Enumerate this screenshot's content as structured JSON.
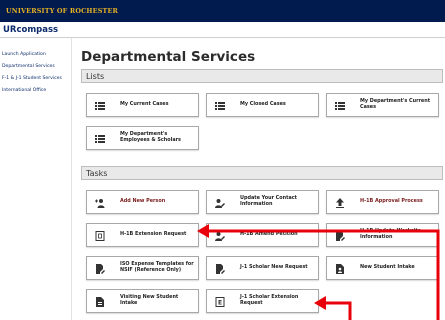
{
  "header": {
    "university": "UNIVERSITY OF ROCHESTER",
    "app_name": "URcompass"
  },
  "sidebar": {
    "items": [
      {
        "label": "Launch Application"
      },
      {
        "label": "Departmental Services"
      },
      {
        "label": "F-1 & J-1 Student Services"
      },
      {
        "label": "International Office"
      }
    ]
  },
  "main": {
    "title": "Departmental Services",
    "lists": {
      "header": "Lists",
      "cards": [
        {
          "label": "My Current Cases",
          "icon": "list-icon"
        },
        {
          "label": "My Closed Cases",
          "icon": "list-icon"
        },
        {
          "label": "My Department's Current Cases",
          "icon": "list-icon"
        },
        {
          "label": "My Department's Employees & Scholars",
          "icon": "list-icon"
        }
      ]
    },
    "tasks": {
      "header": "Tasks",
      "cards": [
        {
          "label": "Add New Person",
          "icon": "person-add-icon"
        },
        {
          "label": "Update Your Contact Information",
          "icon": "edit-person-icon"
        },
        {
          "label": "H-1B Approval Process",
          "icon": "upload-icon"
        },
        {
          "label": "H-1B Extension Request",
          "icon": "document-icon"
        },
        {
          "label": "H-1B Amend Petition",
          "icon": "edit-person-icon"
        },
        {
          "label": "H-1B Update Worksite Information",
          "icon": "edit-document-icon"
        },
        {
          "label": "ISO Expense Templates for NSIF (Reference Only)",
          "icon": "edit-document-icon"
        },
        {
          "label": "J-1 Scholar New Request",
          "icon": "edit-document-icon"
        },
        {
          "label": "New Student Intake",
          "icon": "file-person-icon"
        },
        {
          "label": "Visiting New Student Intake",
          "icon": "file-icon"
        },
        {
          "label": "J-1 Scholar Extension Request",
          "icon": "extension-icon"
        }
      ]
    }
  },
  "colors": {
    "header_bg": "#021b4e",
    "university_gold": "#e8b423",
    "link_navy": "#0b2a6b",
    "accent_text": "#7a1b1b",
    "annotation_red": "#e8000b"
  }
}
